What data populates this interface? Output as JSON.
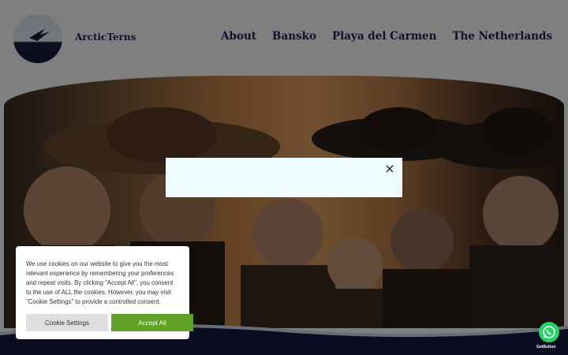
{
  "header": {
    "site_name": "ArcticTerns",
    "nav": [
      "About",
      "Bansko",
      "Playa del Carmen",
      "The Netherlands"
    ]
  },
  "modal": {
    "close_symbol": "×",
    "close_icon": "close-icon"
  },
  "cookie_notice": {
    "text": "We use cookies on our website to give you the most relevant experience by remembering your preferences and repeat visits. By clicking \"Accept All\", you consent to the use of ALL the cookies. However, you may visit \"Cookie Settings\" to provide a controlled consent.",
    "settings_label": "Cookie Settings",
    "accept_label": "Accept All"
  },
  "whatsapp": {
    "icon": "whatsapp-icon",
    "caption": "GetButton"
  },
  "colors": {
    "nav_text": "#1d2158",
    "accept_button": "#61a229",
    "settings_button": "#dedfe0",
    "whatsapp": "#25d366",
    "footer_wave": "#151a45",
    "modal_bg": "#eefbff"
  }
}
